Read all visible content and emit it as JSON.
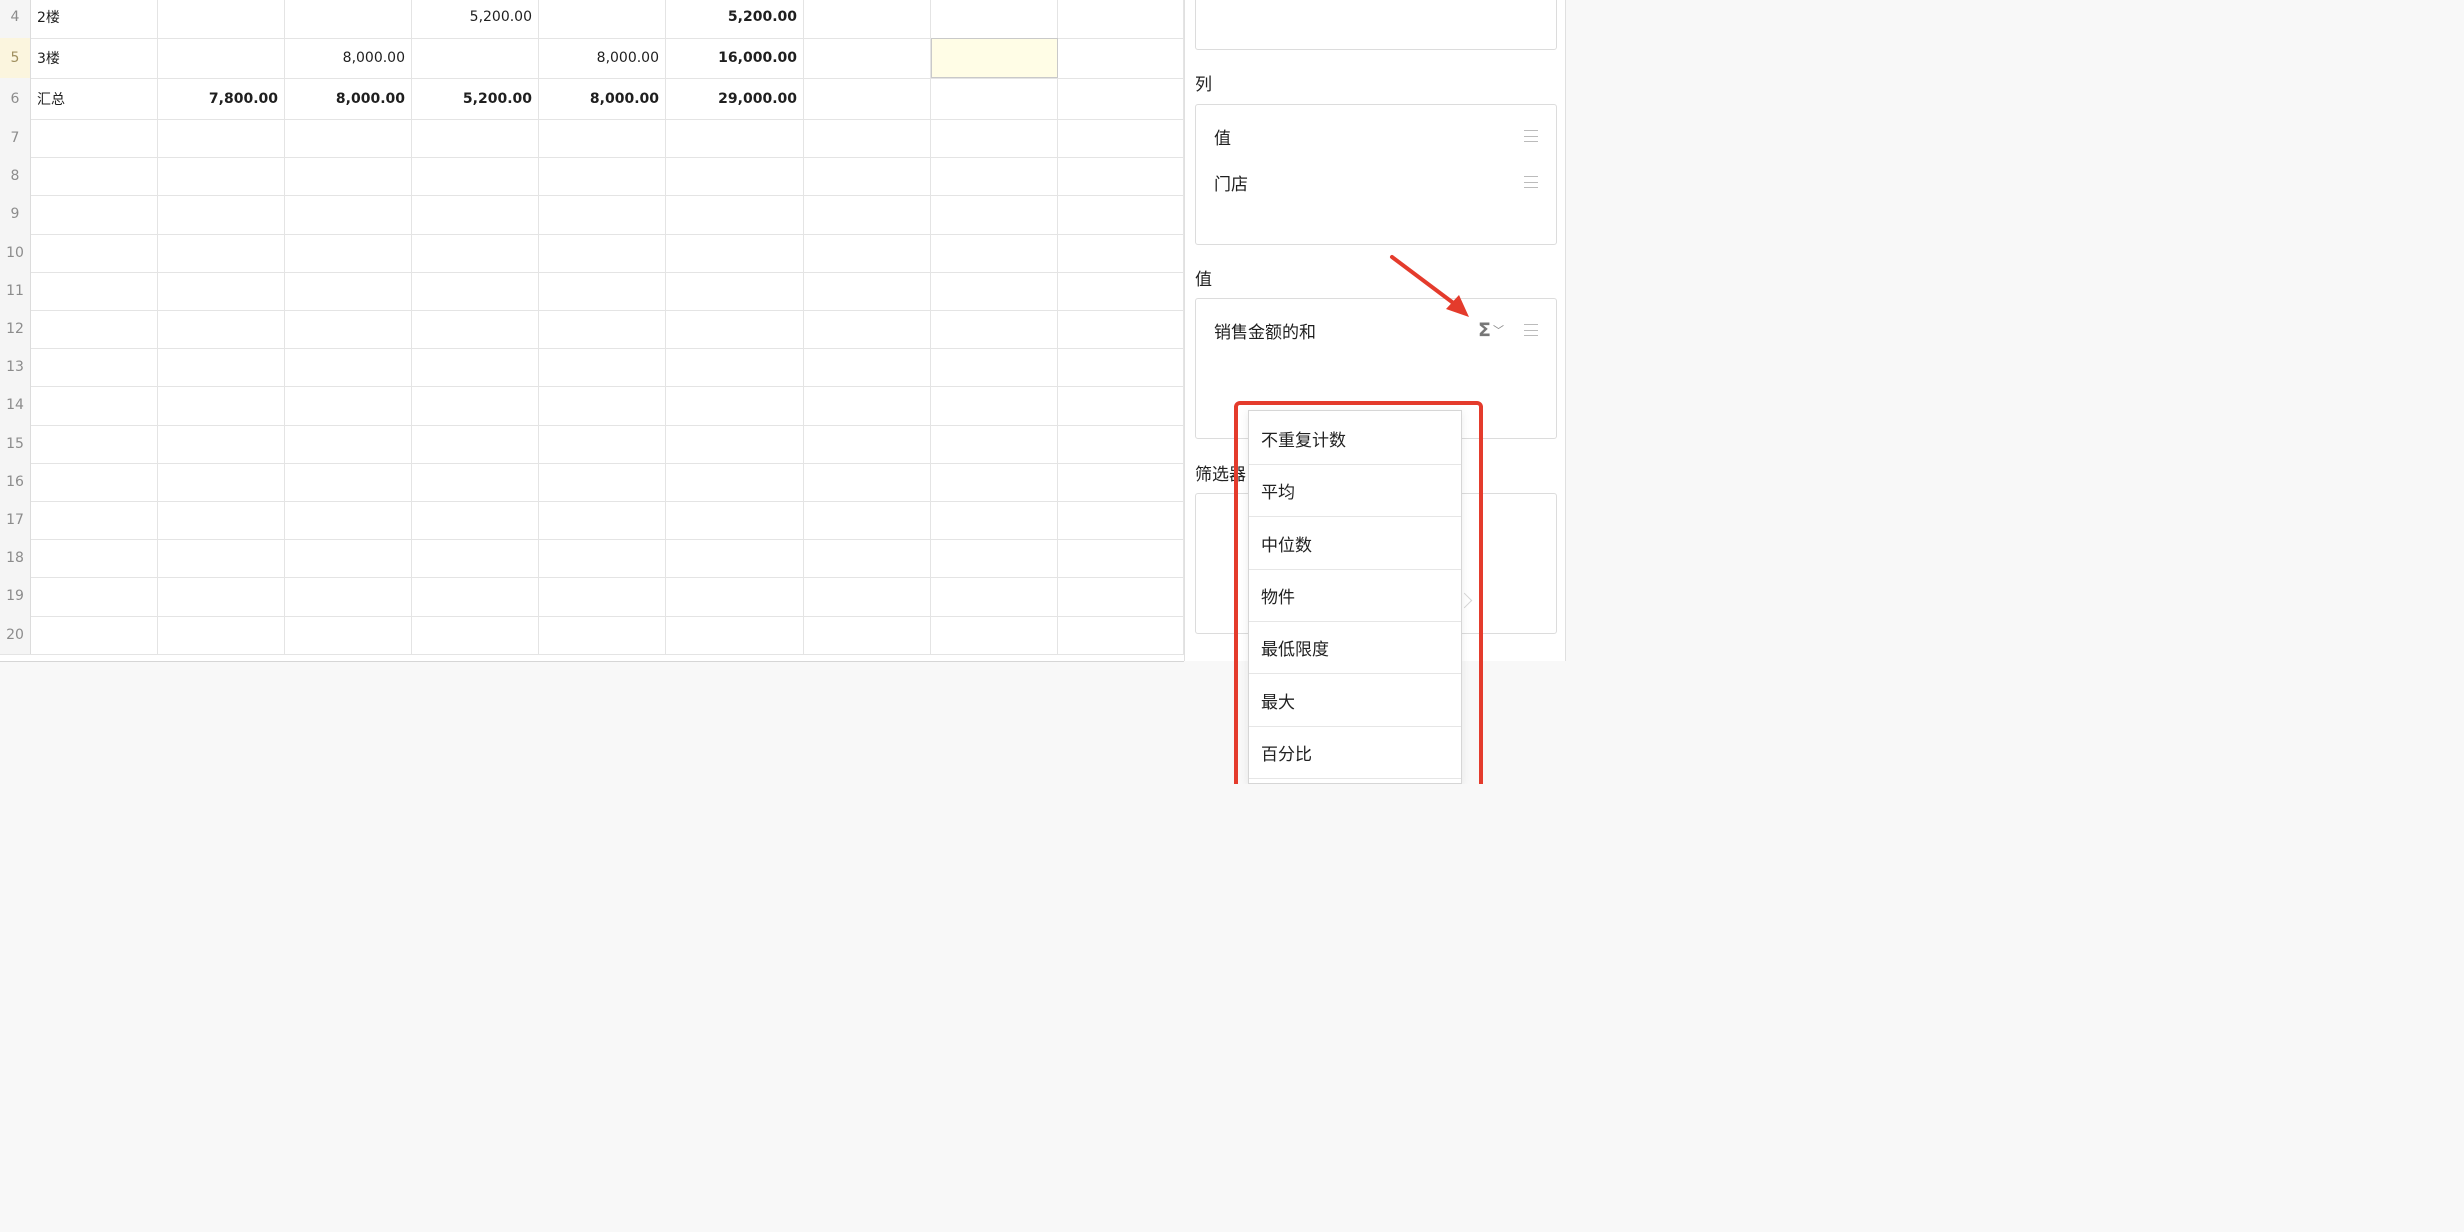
{
  "grid": {
    "rows": [
      {
        "num": "4",
        "label": "2楼",
        "values": [
          "",
          "",
          "5,200.00",
          "",
          "5,200.00"
        ]
      },
      {
        "num": "5",
        "label": "3楼",
        "values": [
          "",
          "8,000.00",
          "",
          "8,000.00",
          "16,000.00"
        ]
      },
      {
        "num": "6",
        "label": "汇总",
        "values": [
          "7,800.00",
          "8,000.00",
          "5,200.00",
          "8,000.00",
          "29,000.00"
        ]
      },
      {
        "num": "7"
      },
      {
        "num": "8"
      },
      {
        "num": "9"
      },
      {
        "num": "10"
      },
      {
        "num": "11"
      },
      {
        "num": "12"
      },
      {
        "num": "13"
      },
      {
        "num": "14"
      },
      {
        "num": "15"
      },
      {
        "num": "16"
      },
      {
        "num": "17"
      },
      {
        "num": "18"
      },
      {
        "num": "19"
      },
      {
        "num": "20"
      }
    ]
  },
  "panel": {
    "columns_title": "列",
    "columns": [
      {
        "label": "值",
        "icon": "drag-handle-icon"
      },
      {
        "label": "门店",
        "icon": "drag-handle-icon"
      }
    ],
    "values_title": "值",
    "values": [
      {
        "label": "销售金额的和",
        "agg_icon": "sigma-icon",
        "chevron": "chevron-down-icon"
      }
    ],
    "filters_title": "筛选器"
  },
  "dropdown": {
    "items": [
      "不重复计数",
      "平均",
      "中位数",
      "物件",
      "最低限度",
      "最大",
      "百分比"
    ]
  },
  "colors": {
    "highlight": "#e43b2c",
    "selected_cell": "#fffde6",
    "active_row_header": "#fbf5de"
  }
}
